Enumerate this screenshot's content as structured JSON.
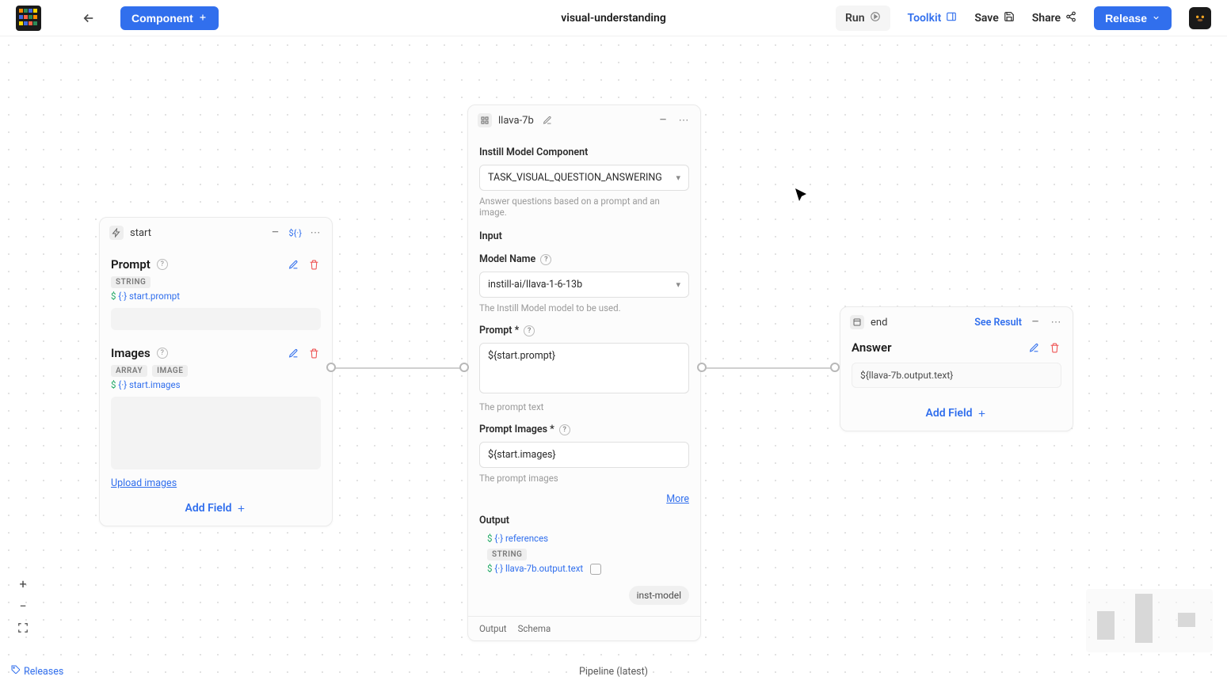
{
  "topbar": {
    "component_btn": "Component",
    "title": "visual-understanding",
    "run": "Run",
    "toolkit": "Toolkit",
    "save": "Save",
    "share": "Share",
    "release": "Release"
  },
  "start_node": {
    "name": "start",
    "ref_token": "${·}",
    "prompt": {
      "label": "Prompt",
      "type_badge": "STRING",
      "ref": "start.prompt"
    },
    "images": {
      "label": "Images",
      "type_badges": [
        "ARRAY",
        "IMAGE"
      ],
      "ref": "start.images",
      "upload_label": "Upload images"
    },
    "add_field": "Add Field"
  },
  "llava_node": {
    "name": "llava-7b",
    "heading": "Instill Model Component",
    "task_select": "TASK_VISUAL_QUESTION_ANSWERING",
    "task_helper": "Answer questions based on a prompt and an image.",
    "input_label": "Input",
    "model_name_label": "Model Name",
    "model_name_value": "instill-ai/llava-1-6-13b",
    "model_name_helper": "The Instill Model model to be used.",
    "prompt_label": "Prompt *",
    "prompt_value": "${start.prompt}",
    "prompt_helper": "The prompt text",
    "prompt_images_label": "Prompt Images *",
    "prompt_images_value": "${start.images}",
    "prompt_images_helper": "The prompt images",
    "more": "More",
    "output_label": "Output",
    "output_references_label": "references",
    "output_type_badge": "STRING",
    "output_ref": "llava-7b.output.text",
    "tag": "inst-model",
    "tab_output": "Output",
    "tab_schema": "Schema"
  },
  "end_node": {
    "name": "end",
    "see_result": "See Result",
    "answer_label": "Answer",
    "answer_value": "${llava-7b.output.text}",
    "add_field": "Add Field"
  },
  "bottom": {
    "releases": "Releases",
    "pipeline_status": "Pipeline (latest)"
  }
}
